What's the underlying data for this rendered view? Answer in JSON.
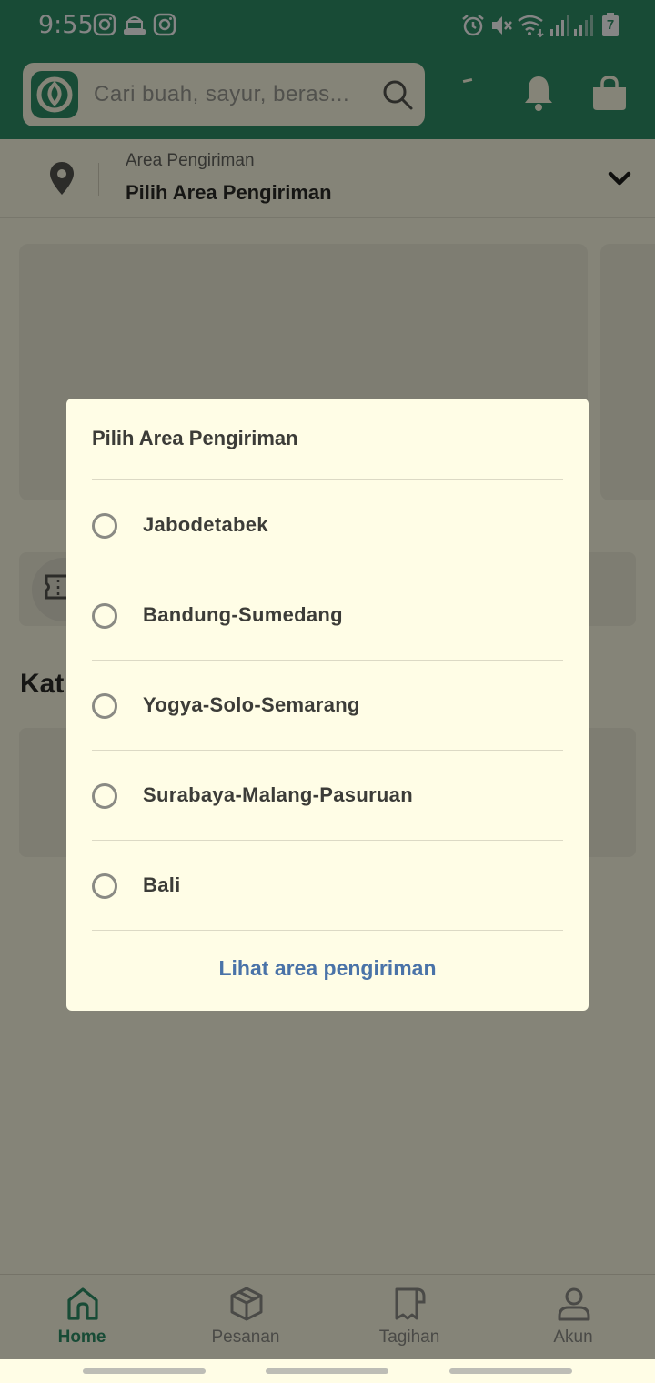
{
  "status_bar": {
    "time": "9:55",
    "left_icons": [
      "instagram-icon",
      "muslim-app-icon",
      "instagram-icon"
    ],
    "right_icons": [
      "alarm-icon",
      "vibrate-mute-icon",
      "wifi-icon",
      "signal-icon",
      "signal-icon",
      "battery-icon"
    ],
    "battery_text": "7"
  },
  "header": {
    "search_placeholder": "Cari buah, sayur, beras...",
    "icons": [
      "app-logo-icon",
      "search-icon",
      "bell-icon",
      "shopping-bag-icon"
    ]
  },
  "delivery_area": {
    "label": "Area Pengiriman",
    "value": "Pilih Area Pengiriman"
  },
  "main": {
    "section_title_partial": "Kat"
  },
  "dialog": {
    "title": "Pilih Area Pengiriman",
    "options": [
      {
        "label": "Jabodetabek",
        "selected": false
      },
      {
        "label": "Bandung-Sumedang",
        "selected": false
      },
      {
        "label": "Yogya-Solo-Semarang",
        "selected": false
      },
      {
        "label": "Surabaya-Malang-Pasuruan",
        "selected": false
      },
      {
        "label": "Bali",
        "selected": false
      }
    ],
    "link_label": "Lihat area pengiriman"
  },
  "bottom_nav": {
    "items": [
      {
        "label": "Home",
        "icon": "home-icon",
        "active": true
      },
      {
        "label": "Pesanan",
        "icon": "box-icon",
        "active": false
      },
      {
        "label": "Tagihan",
        "icon": "receipt-icon",
        "active": false
      },
      {
        "label": "Akun",
        "icon": "user-icon",
        "active": false
      }
    ]
  },
  "colors": {
    "primary_green": "#2f9068",
    "surface": "#fffde6",
    "link_blue": "#4a73a8",
    "text_dark": "#3c3c38"
  }
}
